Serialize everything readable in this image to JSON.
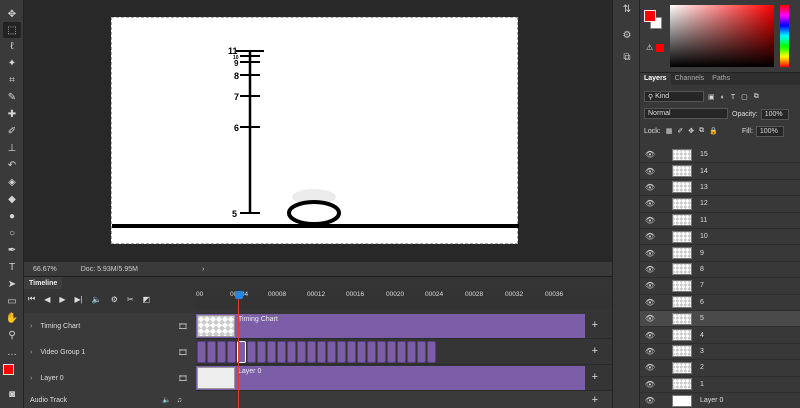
{
  "status": {
    "zoom": "66.67%",
    "doc": "Doc: 5.93M/5.95M"
  },
  "drawing": {
    "labels": [
      "11",
      "10",
      "9",
      "8",
      "7",
      "6",
      "5"
    ]
  },
  "timeline": {
    "tab": "Timeline",
    "ticks": [
      "00",
      "00004",
      "00008",
      "00012",
      "00016",
      "00020",
      "00024",
      "00028",
      "00032",
      "00036"
    ],
    "tracks": [
      {
        "name": "Timing Chart",
        "bar_label": "Timing Chart"
      },
      {
        "name": "Video Group 1",
        "bar_label": ""
      },
      {
        "name": "Layer 0",
        "bar_label": "Layer 0"
      }
    ],
    "audio": "Audio Track"
  },
  "layers_panel": {
    "tabs": [
      "Layers",
      "Channels",
      "Paths"
    ],
    "kind": "Kind",
    "blend_mode": "Normal",
    "opacity_label": "Opacity:",
    "opacity": "100%",
    "lock_label": "Lock:",
    "fill_label": "Fill:",
    "fill": "100%",
    "layers": [
      "15",
      "14",
      "13",
      "12",
      "11",
      "10",
      "9",
      "8",
      "7",
      "6",
      "5",
      "4",
      "3",
      "2",
      "1",
      "Layer 0"
    ],
    "selected": "5"
  },
  "colors": {
    "foreground": "#ff0000",
    "background": "#ffffff",
    "track": "#7b5ea7",
    "playhead": "#1e88e5"
  }
}
